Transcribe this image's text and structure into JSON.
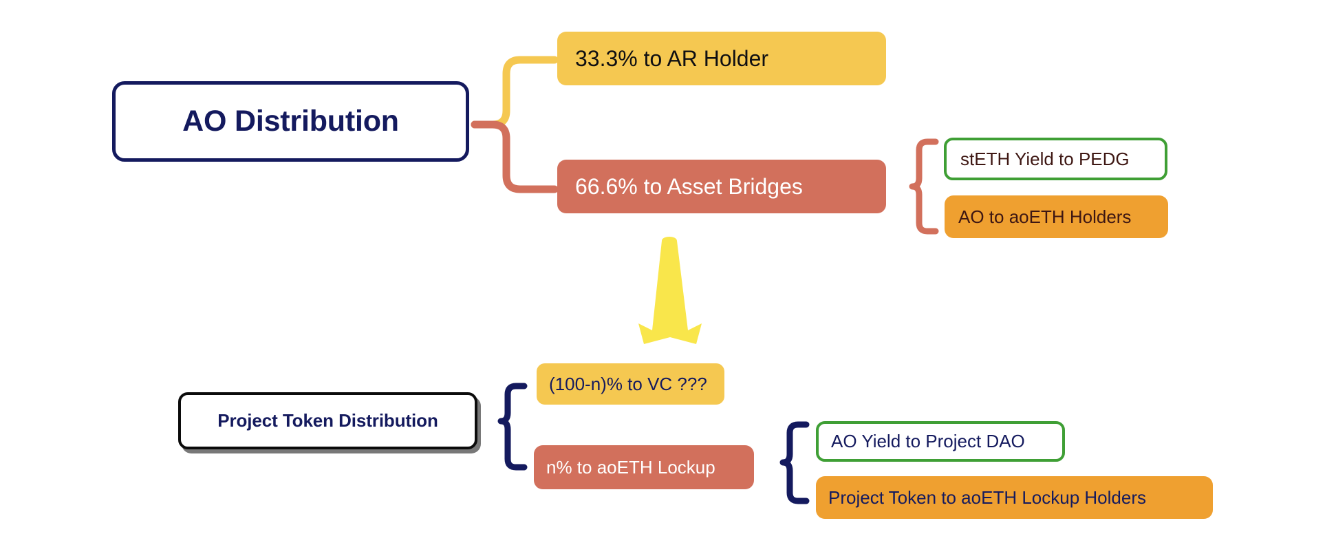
{
  "diagram": {
    "title": "AO Distribution",
    "background_color": "#ffffff",
    "nodes": {
      "ao_distribution": {
        "label": "AO Distribution",
        "border_color": "#141a5e",
        "text_color": "#141a5e",
        "fill_color": "#ffffff"
      },
      "ar_holder": {
        "label": "33.3% to AR Holder",
        "fill_color": "#f5c851",
        "text_color": "#0f0f12"
      },
      "asset_bridges": {
        "label": "66.6% to Asset Bridges",
        "fill_color": "#d2705c",
        "text_color": "#ffffff"
      },
      "steth_yield": {
        "label": "stETH Yield to PEDG",
        "fill_color": "#ffffff",
        "border_color": "#3f9f35",
        "text_color": "#3e1713"
      },
      "ao_aoeth_holders": {
        "label": "AO to aoETH Holders",
        "fill_color": "#efa030",
        "text_color": "#3e1713"
      },
      "project_token_distribution": {
        "label": "Project Token Distribution",
        "border_color": "#0b0b0b",
        "text_color": "#141a5e",
        "fill_color": "#ffffff"
      },
      "vc": {
        "label": "(100-n)% to VC ???",
        "fill_color": "#f5c851",
        "text_color": "#141a5e"
      },
      "aoeth_lockup": {
        "label": "n% to aoETH Lockup",
        "fill_color": "#d2705c",
        "text_color": "#ffffff"
      },
      "ao_yield_dao": {
        "label": "AO Yield to Project DAO",
        "fill_color": "#ffffff",
        "border_color": "#3f9f35",
        "text_color": "#141a5e"
      },
      "project_token_holders": {
        "label": "Project Token to aoETH Lockup Holders",
        "fill_color": "#efa030",
        "text_color": "#141a5e"
      }
    },
    "connectors": {
      "brace_top_upper_color": "#f5c851",
      "brace_top_lower_color": "#d2705c",
      "brace_asset_bridges_color": "#d2705c",
      "brace_project_color": "#141a5e",
      "brace_lockup_color": "#141a5e",
      "flow_arrow": {
        "name": "down-arrow",
        "color": "#f9e64b",
        "direction": "down"
      }
    }
  }
}
